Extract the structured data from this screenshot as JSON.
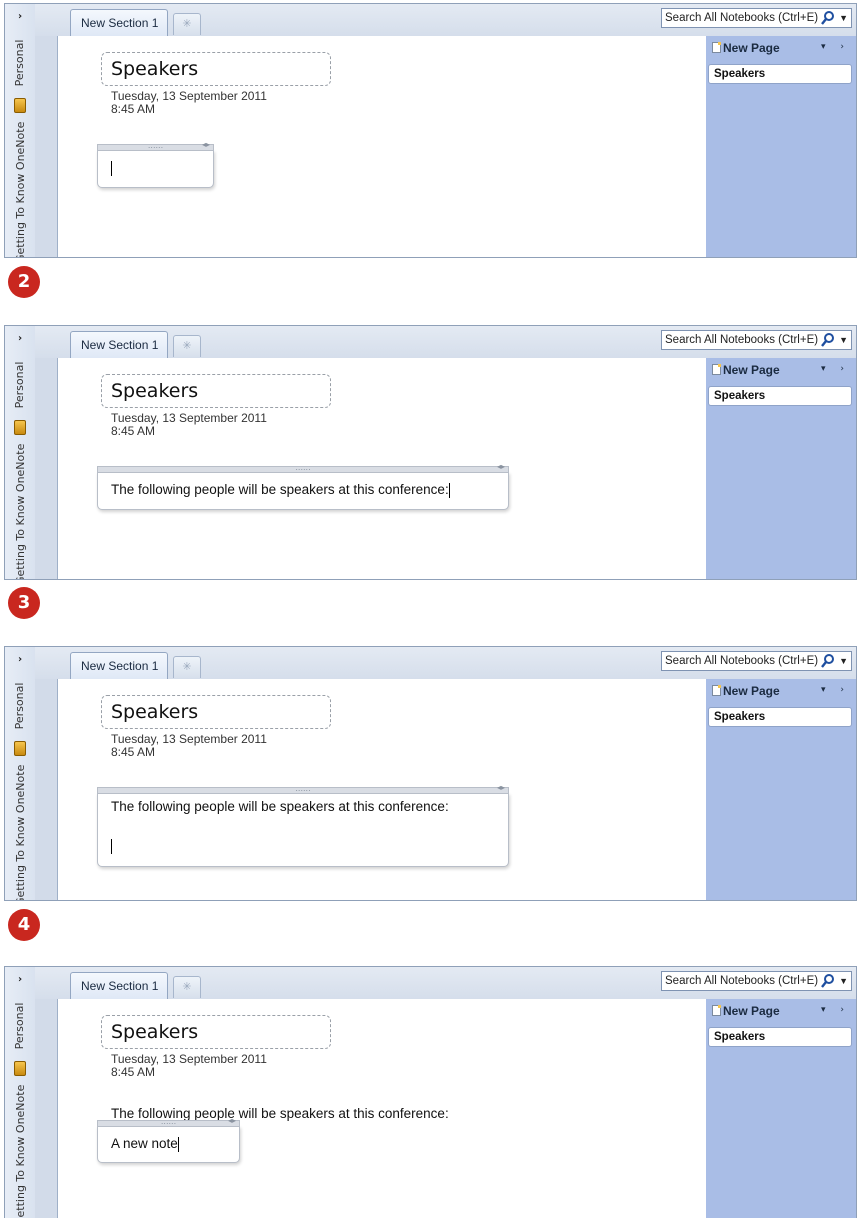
{
  "ui": {
    "expand_label": "›",
    "notebook_personal": "Personal",
    "notebook_getting": "Getting To Know OneNote",
    "section_tab": "New Section 1",
    "new_section_icon": "✳",
    "search_placeholder": "Search All Notebooks (Ctrl+E)",
    "search_dropdown": "▼",
    "page_title": "Speakers",
    "page_date": "Tuesday, 13 September  2011",
    "page_time": "8:45 AM",
    "new_page_label": "New Page",
    "pages_pane_arrows": "▾ ›",
    "page_list_item": "Speakers",
    "note_grip": "......",
    "note_resize": "◂▸",
    "sentence": "The following people will be speakers at this conference:",
    "new_note": "A new note",
    "steps": [
      "2",
      "3",
      "4"
    ]
  },
  "colors": {
    "step_badge": "#c9271f",
    "pages_pane": "#a9bde6"
  }
}
